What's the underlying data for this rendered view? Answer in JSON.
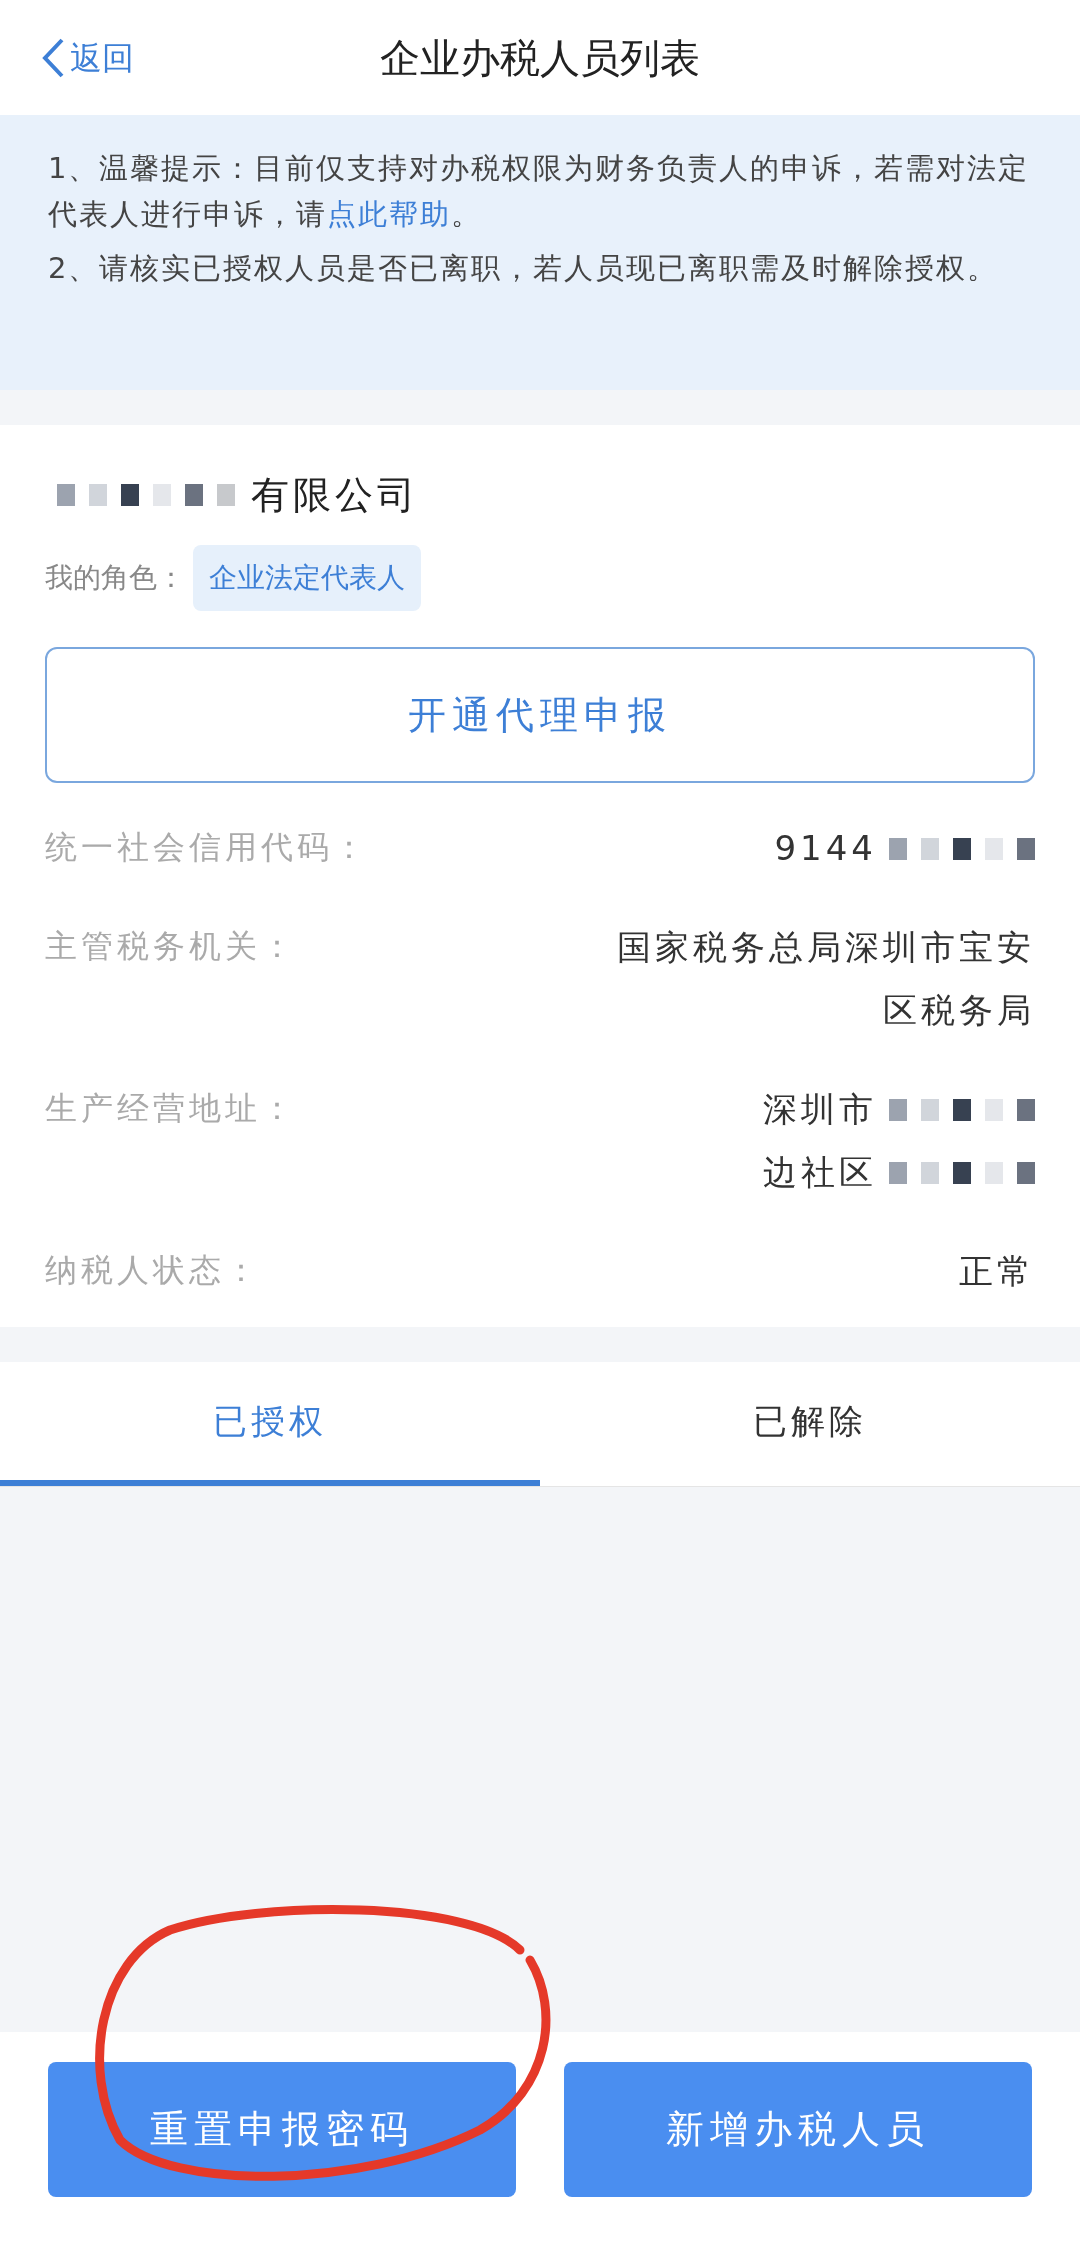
{
  "header": {
    "back": "返回",
    "title": "企业办税人员列表"
  },
  "notice": [
    {
      "text": "1、温馨提示：目前仅支持对办税权限为财务负责人的申诉，若需对法定代表人进行申诉，请",
      "link": "点此帮助",
      "after": "。"
    },
    {
      "text": "2、请核实已授权人员是否已离职，若人员现已离职需及时解除授权。"
    }
  ],
  "company": {
    "name": "有限公司",
    "name_redacted": true,
    "role_label": "我的角色：",
    "role": "企业法定代表人"
  },
  "action_button": "开通代理申报",
  "fields": [
    {
      "label": "统一社会信用代码：",
      "lines": [
        {
          "text": "9144",
          "redacted": true
        }
      ]
    },
    {
      "label": "主管税务机关：",
      "lines": [
        {
          "text": "国家税务总局深圳市宝安",
          "redacted": false
        },
        {
          "text": "区税务局",
          "redacted": false
        }
      ]
    },
    {
      "label": "生产经营地址：",
      "lines": [
        {
          "text": "深圳市",
          "redacted": true
        },
        {
          "text": "边社区",
          "redacted": true
        }
      ]
    },
    {
      "label": "纳税人状态：",
      "lines": [
        {
          "text": "正常",
          "redacted": false
        }
      ]
    }
  ],
  "tabs": [
    {
      "label": "已授权",
      "selected": true
    },
    {
      "label": "已解除",
      "selected": false
    }
  ],
  "buttons": [
    "重置申报密码",
    "新增办税人员"
  ]
}
